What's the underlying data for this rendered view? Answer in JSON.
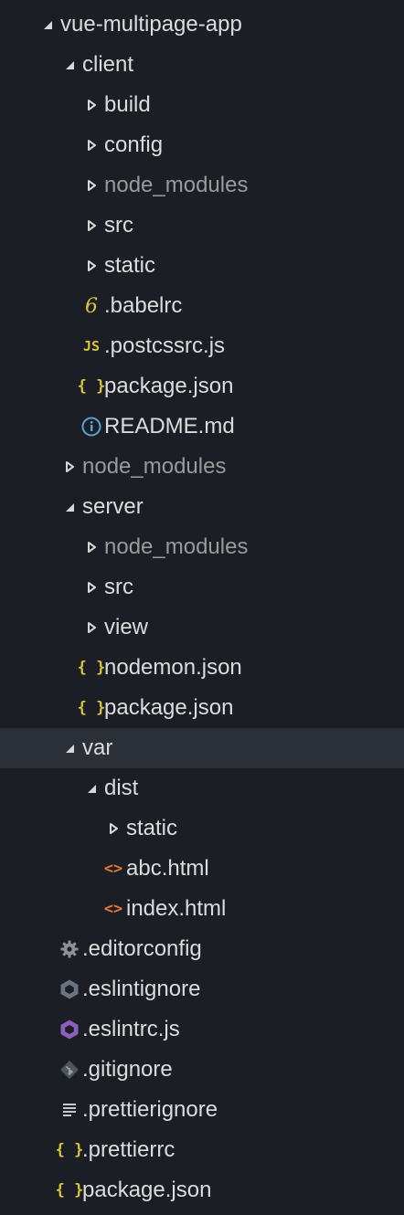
{
  "explorer": {
    "items": [
      {
        "label": "vue-multipage-app",
        "depth": 0,
        "type": "folder",
        "open": true
      },
      {
        "label": "client",
        "depth": 1,
        "type": "folder",
        "open": true
      },
      {
        "label": "build",
        "depth": 2,
        "type": "folder",
        "open": false
      },
      {
        "label": "config",
        "depth": 2,
        "type": "folder",
        "open": false
      },
      {
        "label": "node_modules",
        "depth": 2,
        "type": "folder",
        "open": false,
        "dim": true
      },
      {
        "label": "src",
        "depth": 2,
        "type": "folder",
        "open": false
      },
      {
        "label": "static",
        "depth": 2,
        "type": "folder",
        "open": false
      },
      {
        "label": ".babelrc",
        "depth": 2,
        "type": "file",
        "icon": "babel-icon"
      },
      {
        "label": ".postcssrc.js",
        "depth": 2,
        "type": "file",
        "icon": "javascript-icon"
      },
      {
        "label": "package.json",
        "depth": 2,
        "type": "file",
        "icon": "json-icon"
      },
      {
        "label": "README.md",
        "depth": 2,
        "type": "file",
        "icon": "info-icon"
      },
      {
        "label": "node_modules",
        "depth": 1,
        "type": "folder",
        "open": false,
        "dim": true
      },
      {
        "label": "server",
        "depth": 1,
        "type": "folder",
        "open": true
      },
      {
        "label": "node_modules",
        "depth": 2,
        "type": "folder",
        "open": false,
        "dim": true
      },
      {
        "label": "src",
        "depth": 2,
        "type": "folder",
        "open": false
      },
      {
        "label": "view",
        "depth": 2,
        "type": "folder",
        "open": false
      },
      {
        "label": "nodemon.json",
        "depth": 2,
        "type": "file",
        "icon": "json-icon"
      },
      {
        "label": "package.json",
        "depth": 2,
        "type": "file",
        "icon": "json-icon"
      },
      {
        "label": "var",
        "depth": 1,
        "type": "folder",
        "open": true,
        "selected": true
      },
      {
        "label": "dist",
        "depth": 2,
        "type": "folder",
        "open": true
      },
      {
        "label": "static",
        "depth": 3,
        "type": "folder",
        "open": false
      },
      {
        "label": "abc.html",
        "depth": 3,
        "type": "file",
        "icon": "html-icon"
      },
      {
        "label": "index.html",
        "depth": 3,
        "type": "file",
        "icon": "html-icon"
      },
      {
        "label": ".editorconfig",
        "depth": 1,
        "type": "file",
        "icon": "gear-icon"
      },
      {
        "label": ".eslintignore",
        "depth": 1,
        "type": "file",
        "icon": "eslint-ignore-icon"
      },
      {
        "label": ".eslintrc.js",
        "depth": 1,
        "type": "file",
        "icon": "eslint-icon"
      },
      {
        "label": ".gitignore",
        "depth": 1,
        "type": "file",
        "icon": "git-icon"
      },
      {
        "label": ".prettierignore",
        "depth": 1,
        "type": "file",
        "icon": "lines-icon"
      },
      {
        "label": ".prettierrc",
        "depth": 1,
        "type": "file",
        "icon": "json-icon"
      },
      {
        "label": "package.json",
        "depth": 1,
        "type": "file",
        "icon": "json-icon"
      }
    ]
  },
  "icon_glyphs": {
    "babel-icon": "6",
    "javascript-icon": "JS",
    "json-icon": "{ }",
    "info-icon": "i",
    "html-icon": "<>"
  },
  "colors": {
    "background": "#1b1e24",
    "selected_row": "#2b2f37",
    "text": "#dcdcdc",
    "dim_text": "#9a9a9a",
    "json": "#d9c53c",
    "javascript": "#d9c53c",
    "babel": "#d9c53c",
    "info": "#56a6d8",
    "html": "#e37933",
    "gear": "#8a9199",
    "eslint_ignore": "#6b7480",
    "eslint": "#8b5fbf",
    "git": "#4f5660",
    "lines": "#c8c8c8"
  }
}
